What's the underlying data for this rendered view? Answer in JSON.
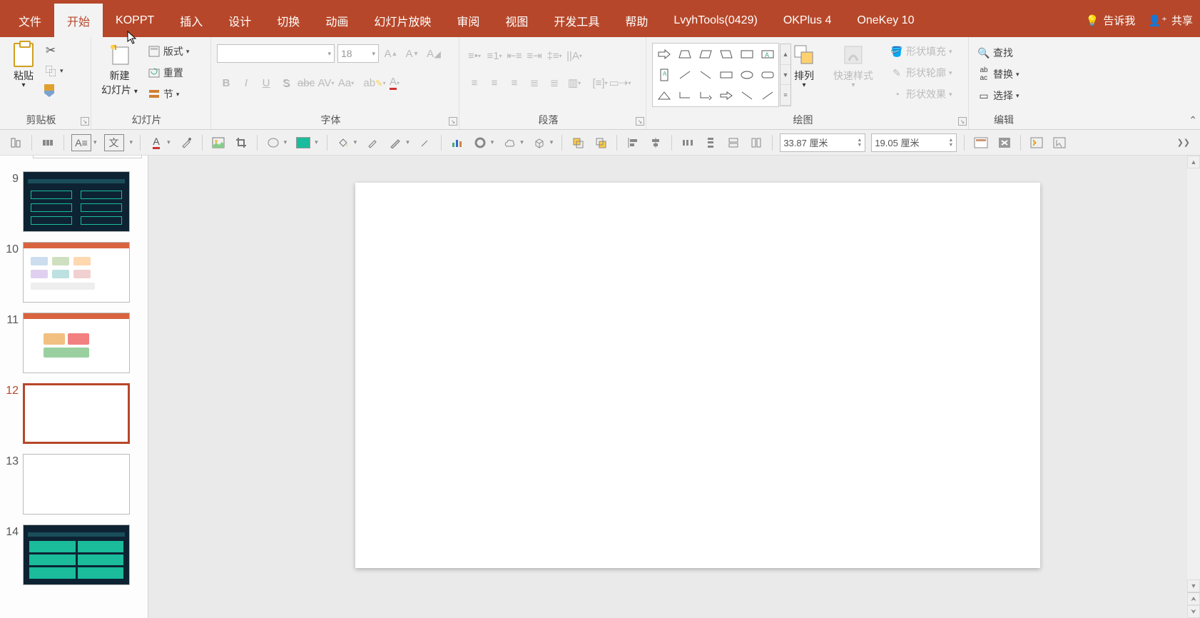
{
  "tabs": {
    "file": "文件",
    "home": "开始",
    "koppt": "KOPPT",
    "insert": "插入",
    "design": "设计",
    "transition": "切换",
    "animation": "动画",
    "slideshow": "幻灯片放映",
    "review": "审阅",
    "view": "视图",
    "developer": "开发工具",
    "help": "帮助",
    "lvyh": "LvyhTools(0429)",
    "okplus": "OKPlus 4",
    "onekey": "OneKey 10"
  },
  "titlebar": {
    "tellme": "告诉我",
    "share": "共享"
  },
  "groups": {
    "clipboard": "剪贴板",
    "slides": "幻灯片",
    "font": "字体",
    "paragraph": "段落",
    "drawing": "绘图",
    "editing": "编辑"
  },
  "clipboard": {
    "paste": "粘贴"
  },
  "slides": {
    "new_slide_line1": "新建",
    "new_slide_line2": "幻灯片",
    "layout": "版式",
    "reset": "重置",
    "section": "节"
  },
  "font": {
    "size_value": "18"
  },
  "drawing": {
    "arrange": "排列",
    "quick_styles": "快速样式",
    "shape_fill": "形状填充",
    "shape_outline": "形状轮廓",
    "shape_effects": "形状效果"
  },
  "editing": {
    "find": "查找",
    "replace": "替换",
    "select": "选择"
  },
  "secondary": {
    "width_value": "33.87 厘米",
    "height_value": "19.05 厘米",
    "text_label": "文"
  },
  "thumbnails": [
    {
      "num": "9",
      "variant": "dark",
      "active": false
    },
    {
      "num": "10",
      "variant": "ppt",
      "active": false
    },
    {
      "num": "11",
      "variant": "ppt2",
      "active": false
    },
    {
      "num": "12",
      "variant": "blank",
      "active": true
    },
    {
      "num": "13",
      "variant": "blank",
      "active": false
    },
    {
      "num": "14",
      "variant": "dark",
      "active": false
    }
  ]
}
